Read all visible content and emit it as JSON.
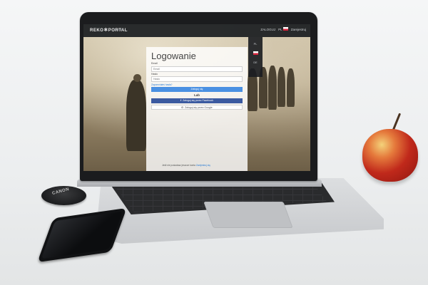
{
  "site": {
    "logo_text": "REKO",
    "logo_star": "✱",
    "logo_text2": "PORTAL",
    "nav_item": "O nas",
    "login_link": "ZALOGUJ",
    "lang_code": "PL",
    "register_link": "Zarejestruj"
  },
  "language_dropdown": {
    "options": [
      {
        "code": "PL"
      },
      {
        "code": "EN"
      },
      {
        "code": "DE"
      }
    ]
  },
  "login": {
    "title": "Logowanie",
    "email_label": "Email",
    "email_placeholder": "Email",
    "password_label": "Hasło",
    "password_placeholder": "Hasło",
    "forgot_link": "Zapomniałeś hasła?",
    "login_button": "Zaloguj się",
    "or_text": "Lub",
    "facebook_button": "Zaloguj się przez Facebook",
    "facebook_icon": "f",
    "google_button": "Zaloguj się przez Google",
    "google_icon": "G",
    "register_prompt": "Jeśli nie posiadasz jeszcze konta",
    "register_link": "Zarejestruj się"
  },
  "props": {
    "lens_cap_text": "CANON"
  },
  "colors": {
    "primary_button": "#4a90e2",
    "facebook_button": "#3b5aa0",
    "topbar": "#191c20"
  }
}
